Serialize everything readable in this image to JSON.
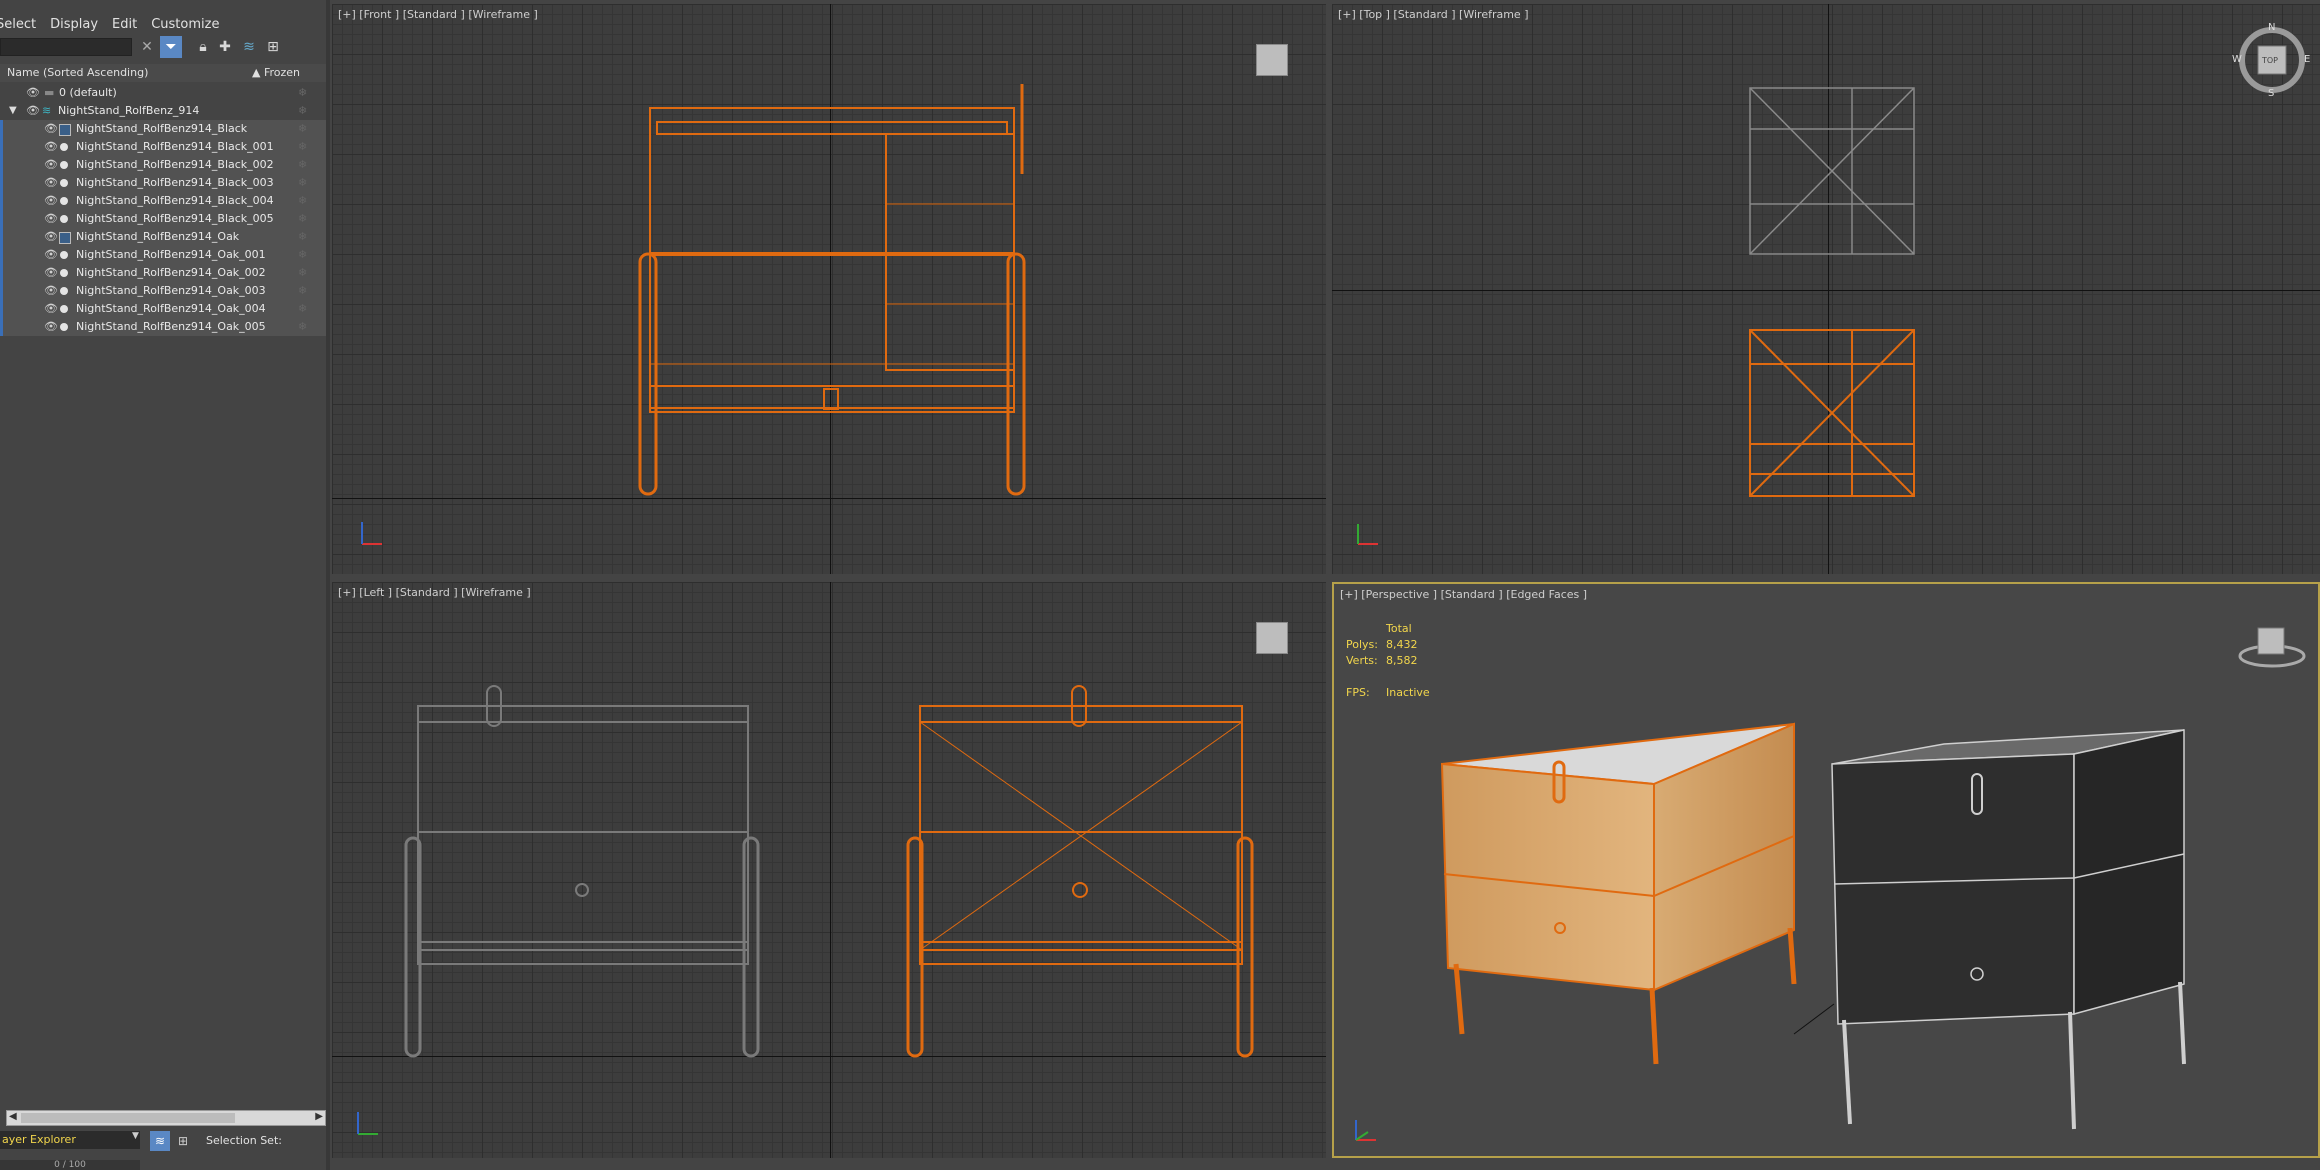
{
  "menu": [
    "Select",
    "Display",
    "Edit",
    "Customize"
  ],
  "explorer": {
    "search_value": "",
    "column_name": "Name (Sorted Ascending)",
    "column_frozen": "Frozen",
    "rows": [
      {
        "label": "0 (default)",
        "type": "layer-default",
        "indent": 0
      },
      {
        "label": "NightStand_RolfBenz_914",
        "type": "layer",
        "indent": 0
      },
      {
        "label": "NightStand_RolfBenz914_Black",
        "type": "group",
        "indent": 1
      },
      {
        "label": "NightStand_RolfBenz914_Black_001",
        "type": "mesh",
        "indent": 1
      },
      {
        "label": "NightStand_RolfBenz914_Black_002",
        "type": "mesh",
        "indent": 1
      },
      {
        "label": "NightStand_RolfBenz914_Black_003",
        "type": "mesh",
        "indent": 1
      },
      {
        "label": "NightStand_RolfBenz914_Black_004",
        "type": "mesh",
        "indent": 1
      },
      {
        "label": "NightStand_RolfBenz914_Black_005",
        "type": "mesh",
        "indent": 1
      },
      {
        "label": "NightStand_RolfBenz914_Oak",
        "type": "group",
        "indent": 1
      },
      {
        "label": "NightStand_RolfBenz914_Oak_001",
        "type": "mesh",
        "indent": 1
      },
      {
        "label": "NightStand_RolfBenz914_Oak_002",
        "type": "mesh",
        "indent": 1
      },
      {
        "label": "NightStand_RolfBenz914_Oak_003",
        "type": "mesh",
        "indent": 1
      },
      {
        "label": "NightStand_RolfBenz914_Oak_004",
        "type": "mesh",
        "indent": 1
      },
      {
        "label": "NightStand_RolfBenz914_Oak_005",
        "type": "mesh",
        "indent": 1
      }
    ],
    "explorer_mode": "ayer Explorer",
    "selection_set_label": "Selection Set:",
    "timeline": "0 / 100"
  },
  "viewports": {
    "front": "[+] [Front ] [Standard ] [Wireframe ]",
    "top": "[+] [Top ] [Standard ] [Wireframe ]",
    "left": "[+] [Left ] [Standard ] [Wireframe ]",
    "perspective": "[+] [Perspective ] [Standard ] [Edged Faces ]"
  },
  "stats": {
    "header": "Total",
    "polys_label": "Polys:",
    "polys": "8,432",
    "verts_label": "Verts:",
    "verts": "8,582",
    "fps_label": "FPS:",
    "fps": "Inactive"
  },
  "compass": {
    "n": "N",
    "s": "S",
    "e": "E",
    "w": "W",
    "cube_top": "TOP"
  },
  "colors": {
    "selection": "#e06a10",
    "stats_text": "#f2d64c",
    "active_border": "#b6a14a"
  }
}
